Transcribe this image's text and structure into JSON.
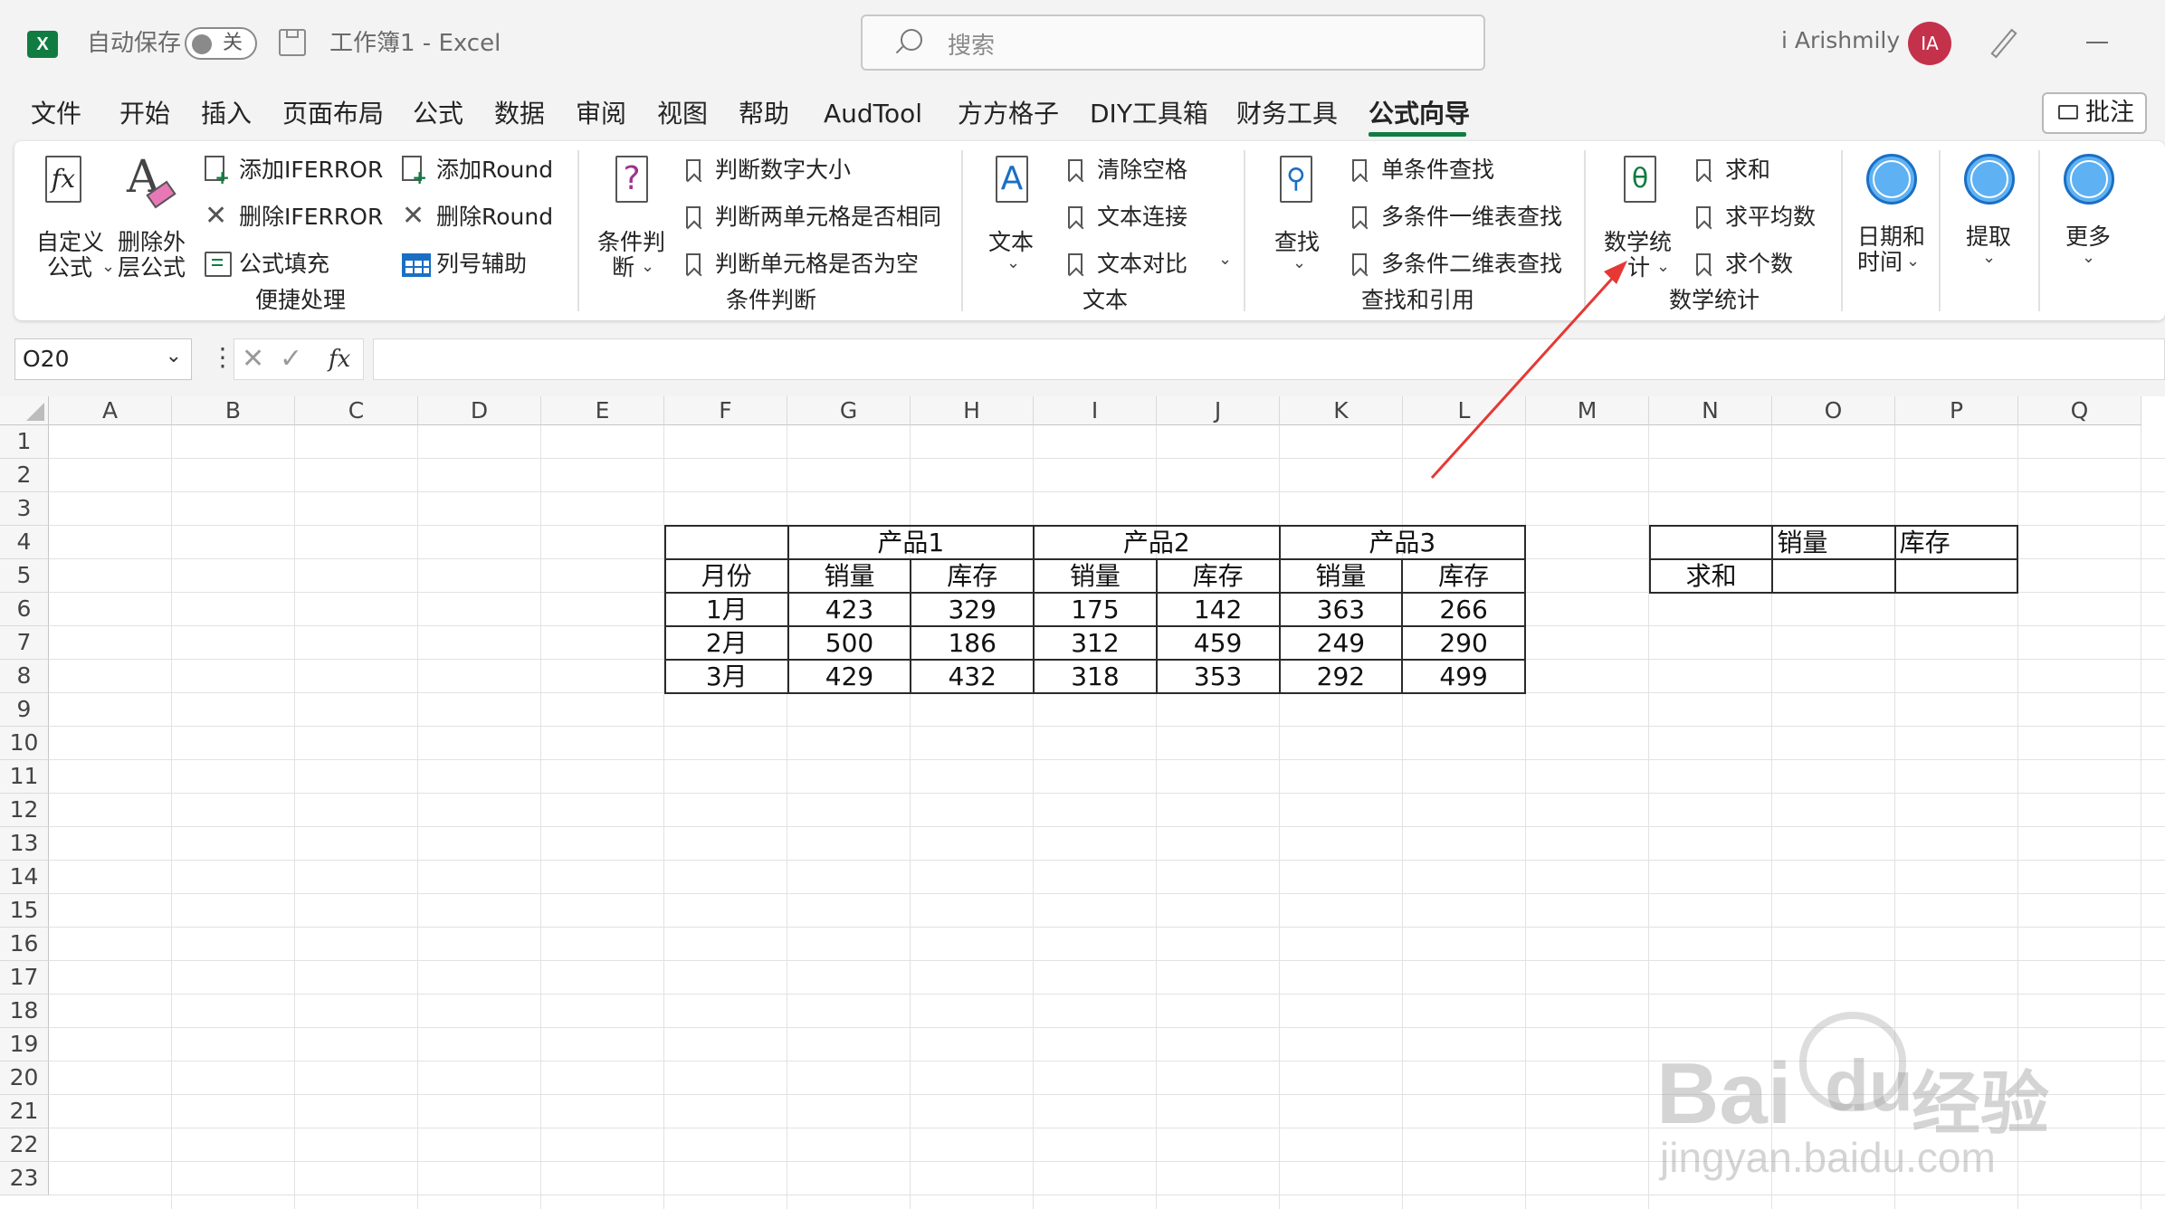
{
  "app": {
    "logo_letter": "X",
    "autosave_label": "自动保存",
    "autosave_state": "关",
    "doc_title": "工作簿1  -  Excel",
    "search_placeholder": "搜索",
    "user_name": "i Arishmily",
    "user_initials": "IA",
    "accent_color": "#107c41"
  },
  "tabs": [
    "文件",
    "开始",
    "插入",
    "页面布局",
    "公式",
    "数据",
    "审阅",
    "视图",
    "帮助",
    "AudTool",
    "方方格子",
    "DIY工具箱",
    "财务工具",
    "公式向导"
  ],
  "active_tab": "公式向导",
  "comment_button": "批注",
  "ribbon": {
    "g1": {
      "custom_formula": [
        "自定义",
        "公式"
      ],
      "remove_outer": [
        "删除外",
        "层公式"
      ],
      "add_iferror": "添加IFERROR",
      "del_iferror": "删除IFERROR",
      "fill_formula": "公式填充",
      "add_round": "添加Round",
      "del_round": "删除Round",
      "col_helper": "列号辅助",
      "group": "便捷处理"
    },
    "g2": {
      "cond": [
        "条件判",
        "断"
      ],
      "judge_num": "判断数字大小",
      "judge_same": "判断两单元格是否相同",
      "judge_empty": "判断单元格是否为空",
      "group": "条件判断"
    },
    "g3": {
      "text": "文本",
      "clear_space": "清除空格",
      "concat": "文本连接",
      "compare": "文本对比",
      "group": "文本"
    },
    "g4": {
      "find": "查找",
      "single": "单条件查找",
      "multi1": "多条件一维表查找",
      "multi2": "多条件二维表查找",
      "group": "查找和引用"
    },
    "g5": {
      "stats": [
        "数学统",
        "计"
      ],
      "sum": "求和",
      "avg": "求平均数",
      "count": "求个数",
      "group": "数学统计"
    },
    "g6": {
      "datetime": [
        "日期和",
        "时间"
      ]
    },
    "g7": {
      "extract": "提取"
    },
    "g8": {
      "more": "更多"
    }
  },
  "formula_bar": {
    "name_box": "O20",
    "fx": "fx",
    "value": ""
  },
  "columns": [
    "A",
    "B",
    "C",
    "D",
    "E",
    "F",
    "G",
    "H",
    "I",
    "J",
    "K",
    "L",
    "M",
    "N",
    "O",
    "P",
    "Q"
  ],
  "rows": [
    "1",
    "2",
    "3",
    "4",
    "5",
    "6",
    "7",
    "8",
    "9",
    "10",
    "11",
    "12",
    "13",
    "14",
    "15",
    "16",
    "17",
    "18",
    "19",
    "20",
    "21",
    "22",
    "23"
  ],
  "table1": {
    "products": [
      "产品1",
      "产品2",
      "产品3"
    ],
    "month_header": "月份",
    "sub_headers": [
      "销量",
      "库存",
      "销量",
      "库存",
      "销量",
      "库存"
    ],
    "data": [
      {
        "month": "1月",
        "vals": [
          "423",
          "329",
          "175",
          "142",
          "363",
          "266"
        ]
      },
      {
        "month": "2月",
        "vals": [
          "500",
          "186",
          "312",
          "459",
          "249",
          "290"
        ]
      },
      {
        "month": "3月",
        "vals": [
          "429",
          "432",
          "318",
          "353",
          "292",
          "499"
        ]
      }
    ]
  },
  "table2": {
    "headers": [
      "销量",
      "库存"
    ],
    "row_label": "求和"
  },
  "watermark": {
    "brand": "Bai",
    "brand2": "du",
    "cn": "经验",
    "url": "jingyan.baidu.com"
  }
}
